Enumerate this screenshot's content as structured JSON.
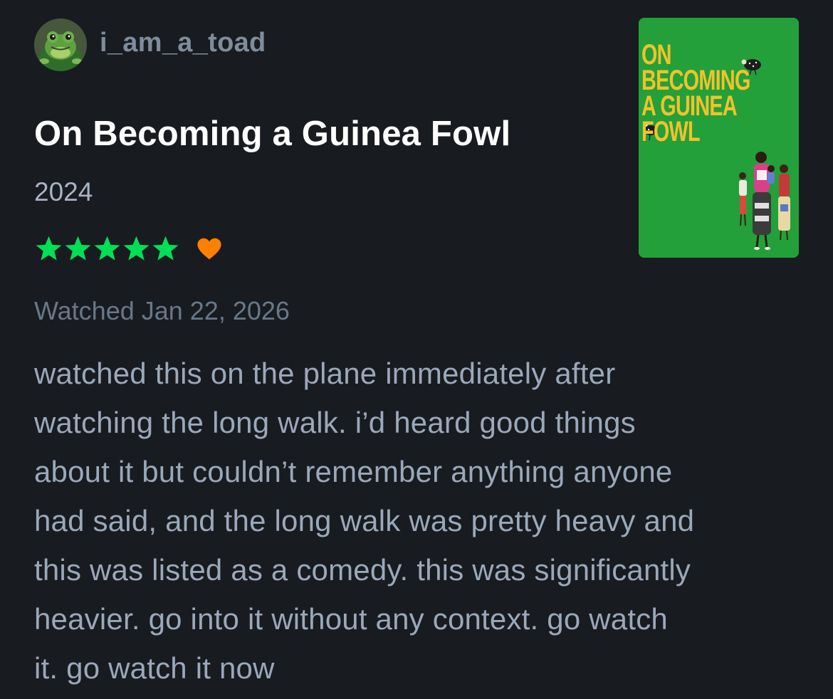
{
  "user": {
    "username": "i_am_a_toad",
    "avatar_icon": "toad-avatar-icon"
  },
  "film": {
    "title": "On Becoming a Guinea Fowl",
    "year": "2024",
    "poster": {
      "title_lines": [
        "ON",
        "BECOMING",
        "A GUINEA",
        "FOWL"
      ],
      "background_color": "#23a03a",
      "title_color": "#f2c22a"
    }
  },
  "rating": {
    "stars": 5,
    "max_stars": 5,
    "star_color": "#00e054",
    "liked": true,
    "heart_color": "#ff8000"
  },
  "watched_label": "Watched Jan 22, 2026",
  "review": {
    "lines": [
      "watched this on the plane immediately after",
      "watching the long walk. i’d heard good things",
      "about it but couldn’t remember anything anyone",
      "had said, and the long walk was pretty heavy and",
      "this was listed as a comedy. this was significantly",
      "heavier. go into it without any context. go watch",
      "it. go watch it now"
    ]
  }
}
